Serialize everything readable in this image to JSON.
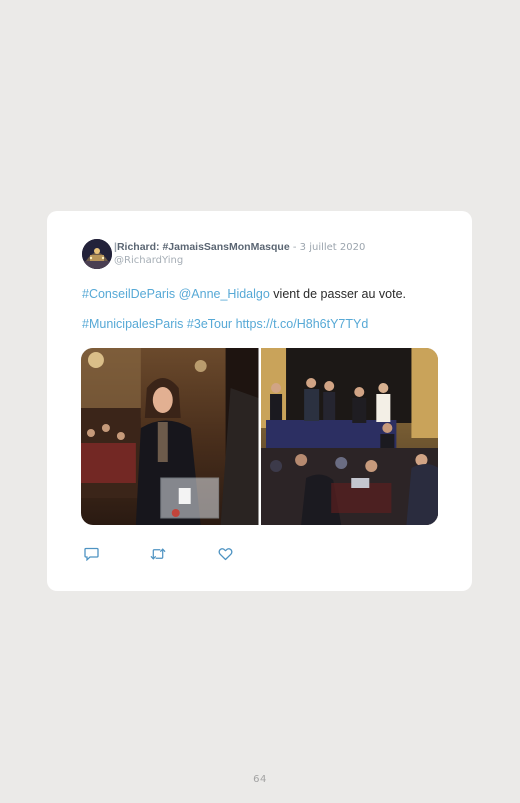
{
  "tweet": {
    "author_pipe": "|",
    "author_name": "Richard: #JamaisSansMonMasque",
    "date_separator": " - ",
    "date": "3 juillet 2020",
    "handle": "@RichardYing",
    "line1": {
      "hashtag": "#ConseilDeParis",
      "mention": "@Anne_Hidalgo",
      "text": " vient de passer au vote."
    },
    "line2": {
      "hashtag1": "#MunicipalesParis",
      "hashtag2": "#3eTour",
      "link": "https://t.co/H8h6tY7TYd"
    },
    "media": [
      "ballot-box-photo",
      "council-room-photo"
    ],
    "actions": [
      "reply-icon",
      "retweet-icon",
      "like-icon"
    ]
  },
  "page": {
    "number": "64"
  },
  "colors": {
    "background": "#ebeae8",
    "card": "#ffffff",
    "link": "#57a9d6",
    "action_icon": "#4e93c2"
  }
}
